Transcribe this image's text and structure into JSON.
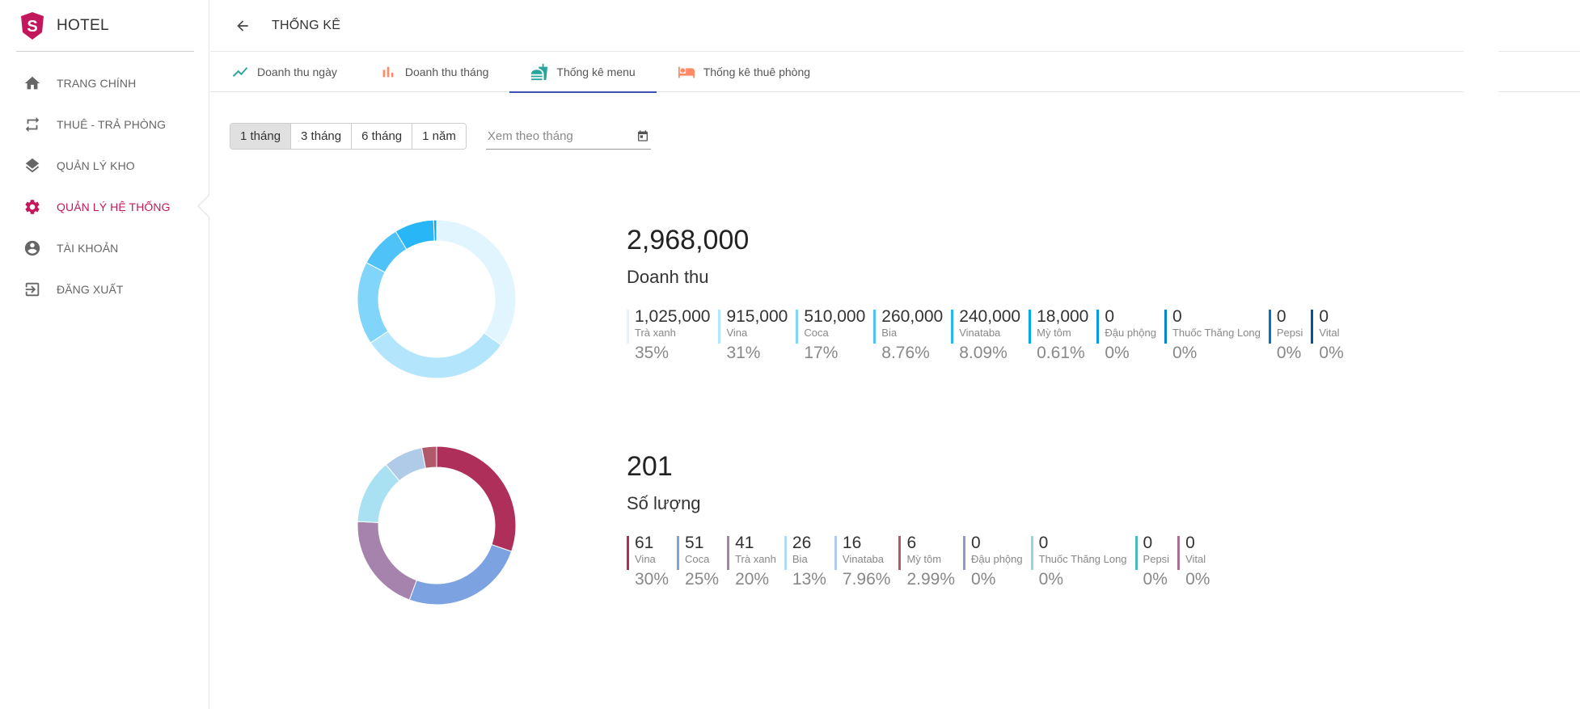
{
  "brand": {
    "name": "HOTEL",
    "logo_letter": "S",
    "logo_color": "#c2185b"
  },
  "sidebar": {
    "items": [
      {
        "label": "TRANG CHÍNH",
        "icon": "home-icon",
        "active": false
      },
      {
        "label": "THUÊ - TRẢ PHÒNG",
        "icon": "swap-icon",
        "active": false
      },
      {
        "label": "QUẢN LÝ KHO",
        "icon": "layers-icon",
        "active": false
      },
      {
        "label": "QUẢN LÝ HỆ THỐNG",
        "icon": "gear-icon",
        "active": true
      },
      {
        "label": "TÀI KHOẢN",
        "icon": "account-icon",
        "active": false
      },
      {
        "label": "ĐĂNG XUẤT",
        "icon": "logout-icon",
        "active": false
      }
    ]
  },
  "header": {
    "title": "THỐNG KÊ",
    "back_icon": "arrow-left-icon"
  },
  "tabs": [
    {
      "label": "Doanh thu ngày",
      "icon": "trend-line-icon",
      "active": false
    },
    {
      "label": "Doanh thu tháng",
      "icon": "bar-chart-icon",
      "active": false
    },
    {
      "label": "Thống kê menu",
      "icon": "food-icon",
      "active": true
    },
    {
      "label": "Thống kê thuê phòng",
      "icon": "bed-icon",
      "active": false
    }
  ],
  "filters": {
    "ranges": [
      "1 tháng",
      "3 tháng",
      "6 tháng",
      "1 năm"
    ],
    "selected": "1 tháng",
    "month_placeholder": "Xem theo tháng",
    "calendar_icon": "calendar-icon"
  },
  "colors": {
    "accent": "#c2185b",
    "tab_indicator": "#3f51b5"
  },
  "chart_data": [
    {
      "type": "pie",
      "total": "2,968,000",
      "caption": "Doanh thu",
      "slices": [
        {
          "value": "1,025,000",
          "name": "Trà xanh",
          "percent": "35%",
          "share": 35,
          "color": "#e1f5fe"
        },
        {
          "value": "915,000",
          "name": "Vina",
          "percent": "31%",
          "share": 31,
          "color": "#b3e5fc"
        },
        {
          "value": "510,000",
          "name": "Coca",
          "percent": "17%",
          "share": 17,
          "color": "#81d4fa"
        },
        {
          "value": "260,000",
          "name": "Bia",
          "percent": "8.76%",
          "share": 8.76,
          "color": "#4fc3f7"
        },
        {
          "value": "240,000",
          "name": "Vinataba",
          "percent": "8.09%",
          "share": 8.09,
          "color": "#29b6f6"
        },
        {
          "value": "18,000",
          "name": "Mỳ tôm",
          "percent": "0.61%",
          "share": 0.61,
          "color": "#03a9f4"
        },
        {
          "value": "0",
          "name": "Đậu phộng",
          "percent": "0%",
          "share": 0,
          "color": "#039be5"
        },
        {
          "value": "0",
          "name": "Thuốc Thăng Long",
          "percent": "0%",
          "share": 0,
          "color": "#0288d1"
        },
        {
          "value": "0",
          "name": "Pepsi",
          "percent": "0%",
          "share": 0,
          "color": "#0277bd"
        },
        {
          "value": "0",
          "name": "Vital",
          "percent": "0%",
          "share": 0,
          "color": "#01579b"
        }
      ]
    },
    {
      "type": "pie",
      "total": "201",
      "caption": "Số lượng",
      "slices": [
        {
          "value": "61",
          "name": "Vina",
          "percent": "30%",
          "share": 30,
          "color": "#ad2f5a"
        },
        {
          "value": "51",
          "name": "Coca",
          "percent": "25%",
          "share": 25,
          "color": "#7da2e2"
        },
        {
          "value": "41",
          "name": "Trà xanh",
          "percent": "20%",
          "share": 20,
          "color": "#a583ad"
        },
        {
          "value": "26",
          "name": "Bia",
          "percent": "13%",
          "share": 13,
          "color": "#a9e1f2"
        },
        {
          "value": "16",
          "name": "Vinataba",
          "percent": "7.96%",
          "share": 7.96,
          "color": "#b0cbe8"
        },
        {
          "value": "6",
          "name": "Mỳ tôm",
          "percent": "2.99%",
          "share": 2.99,
          "color": "#b0596b"
        },
        {
          "value": "0",
          "name": "Đậu phộng",
          "percent": "0%",
          "share": 0,
          "color": "#8f9ac6"
        },
        {
          "value": "0",
          "name": "Thuốc Thăng Long",
          "percent": "0%",
          "share": 0,
          "color": "#8fd6e6"
        },
        {
          "value": "0",
          "name": "Pepsi",
          "percent": "0%",
          "share": 0,
          "color": "#4cb6c4"
        },
        {
          "value": "0",
          "name": "Vital",
          "percent": "0%",
          "share": 0,
          "color": "#ad6f93"
        }
      ]
    }
  ]
}
